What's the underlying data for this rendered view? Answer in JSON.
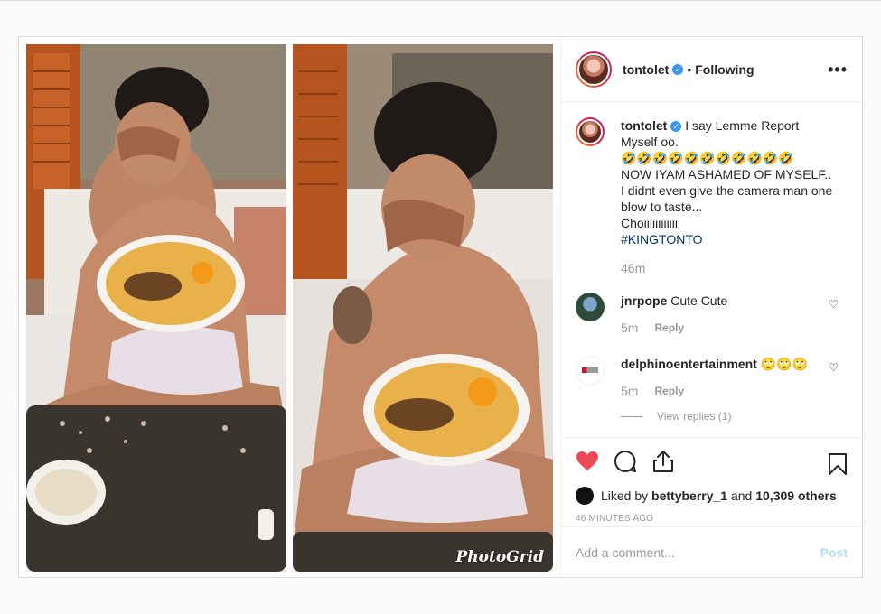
{
  "post": {
    "photo_watermark": "PhotoGrid",
    "header": {
      "username": "tontolet",
      "separator": "•",
      "follow_status": "Following",
      "more_label": "•••"
    },
    "caption": {
      "username": "tontolet",
      "lines": [
        "I say Lemme Report Myself oo.",
        "🤣🤣🤣🤣🤣🤣🤣🤣🤣🤣🤣",
        "NOW IYAM ASHAMED OF MYSELF..",
        "I didnt even give the camera man one blow to taste...",
        "Choiiiiiiiiiiii"
      ],
      "hashtag": "#KINGTONTO",
      "time": "46m"
    },
    "comments": [
      {
        "username": "jnrpope",
        "text": "Cute Cute",
        "time": "5m",
        "reply_label": "Reply"
      },
      {
        "username": "delphinoentertainment",
        "text": "🙄🙄🙄",
        "time": "5m",
        "reply_label": "Reply",
        "view_replies": "View replies (1)"
      }
    ],
    "likes": {
      "prefix": "Liked by",
      "user": "bettyberry_1",
      "middle": "and",
      "others": "10,309 others"
    },
    "posted_ago": "46 MINUTES AGO",
    "add_comment": {
      "placeholder": "Add a comment...",
      "post_label": "Post"
    }
  },
  "icons": {
    "like": "heart-filled-icon",
    "comment": "speech-bubble-icon",
    "share": "share-icon",
    "save": "bookmark-icon",
    "verified": "verified-badge-icon",
    "comment_like": "heart-outline-icon"
  },
  "colors": {
    "like_red": "#ed4956",
    "verified_blue": "#3897f0",
    "hashtag": "#003569",
    "muted": "#999999"
  }
}
